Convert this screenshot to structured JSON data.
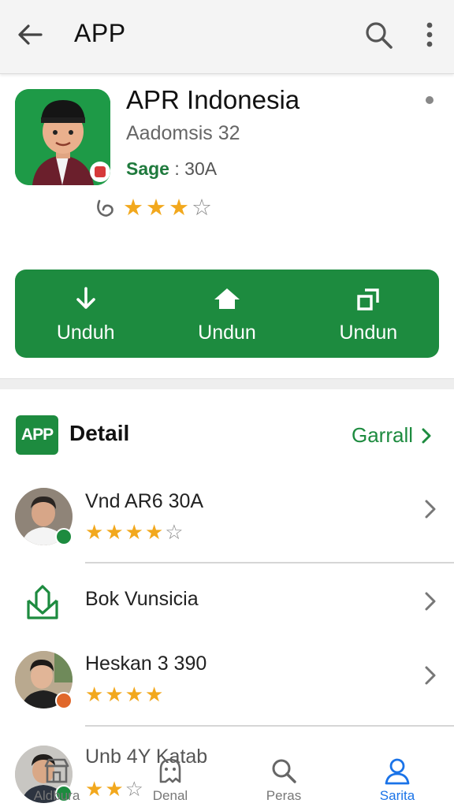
{
  "topbar": {
    "title": "APP",
    "icons": [
      "back-arrow-icon",
      "search-icon",
      "more-vert-icon"
    ]
  },
  "app": {
    "name": "APR Indonesia",
    "subtitle": "Aadomsis 32",
    "size_label": "Sage",
    "size_value": " : 30A",
    "rating": 3,
    "rating_max": 4
  },
  "actions": [
    {
      "label": "Unduh",
      "icon": "download-icon"
    },
    {
      "label": "Undun",
      "icon": "home-icon"
    },
    {
      "label": "Undun",
      "icon": "open-external-icon"
    }
  ],
  "detail": {
    "logo_text": "APP",
    "title": "Detail",
    "link": "Garrall"
  },
  "list": [
    {
      "title": "Vnd AR6 30A",
      "stars": 4,
      "stars_max": 5,
      "badge_color": "#1d8b3f",
      "has_avatar": true
    },
    {
      "title": "Bok Vunsicia",
      "stars": 0,
      "stars_max": 0,
      "badge_color": "",
      "has_avatar": false
    },
    {
      "title": "Heskan 3 390",
      "stars": 4,
      "stars_max": 4,
      "badge_color": "#e0672a",
      "has_avatar": true
    },
    {
      "title": "Unb 4Y Katab",
      "stars": 2,
      "stars_max": 3,
      "badge_color": "#1d8b3f",
      "has_avatar": true
    }
  ],
  "bottomnav": [
    {
      "label": "Aldbura",
      "icon": "store-icon",
      "active": false
    },
    {
      "label": "Denal",
      "icon": "ghost-chat-icon",
      "active": false
    },
    {
      "label": "Peras",
      "icon": "search-icon",
      "active": false
    },
    {
      "label": "Sarita",
      "icon": "profile-icon",
      "active": true
    }
  ],
  "colors": {
    "brand_green": "#1d8b3f",
    "star_gold": "#f2a81d",
    "active_blue": "#1a73e8"
  }
}
